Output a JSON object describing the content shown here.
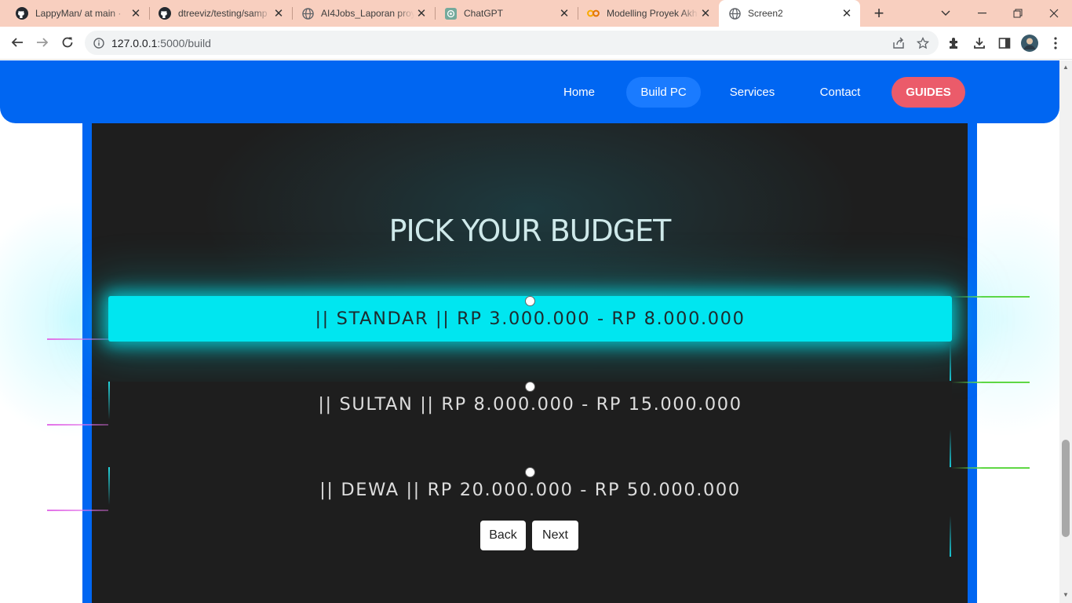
{
  "browser": {
    "tabs": [
      {
        "title": "LappyMan/ at main ·",
        "icon": "github-icon"
      },
      {
        "title": "dtreeviz/testing/samp",
        "icon": "github-icon"
      },
      {
        "title": "AI4Jobs_Laporan proy",
        "icon": "globe-icon"
      },
      {
        "title": "ChatGPT",
        "icon": "chatgpt-icon"
      },
      {
        "title": "Modelling Proyek Akh",
        "icon": "colab-icon"
      },
      {
        "title": "Screen2",
        "icon": "globe-icon"
      }
    ],
    "url_host": "127.0.0.1",
    "url_path": ":5000/build"
  },
  "nav": {
    "home": "Home",
    "build": "Build PC",
    "services": "Services",
    "contact": "Contact",
    "guides": "GUIDES"
  },
  "main": {
    "heading": "PICK YOUR BUDGET",
    "options": [
      {
        "label": "|| STANDAR || RP 3.000.000 - RP 8.000.000",
        "selected": true
      },
      {
        "label": "|| SULTAN || RP 8.000.000 - RP 15.000.000",
        "selected": false
      },
      {
        "label": "|| DEWA || RP 20.000.000 - RP 50.000.000",
        "selected": false
      }
    ],
    "back_label": "Back",
    "next_label": "Next"
  },
  "colors": {
    "nav_blue": "#0066f2",
    "selected_cyan": "#00e6f0",
    "guides_red": "#eb5b6a",
    "panel_dark": "#1e1e1e"
  }
}
